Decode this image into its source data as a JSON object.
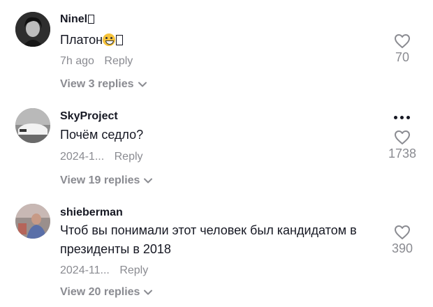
{
  "comments": [
    {
      "username": "Ninel",
      "text": "Платон",
      "date": "7h ago",
      "reply_label": "Reply",
      "likes": "70",
      "view_replies": "View 3 replies"
    },
    {
      "username": "SkyProject",
      "text": "Почём седло?",
      "date": "2024-1...",
      "reply_label": "Reply",
      "likes": "1738",
      "view_replies": "View 19 replies"
    },
    {
      "username": "shieberman",
      "text": "Чтоб вы понимали этот человек был кандидатом в президенты в 2018",
      "date": "2024-11...",
      "reply_label": "Reply",
      "likes": "390",
      "view_replies": "View 20 replies"
    }
  ],
  "colors": {
    "text_primary": "#161823",
    "text_secondary": "#8a8b91"
  },
  "icons": [
    "heart-outline-icon",
    "chevron-down-icon",
    "more-options-icon",
    "grinning-emoji-icon"
  ]
}
